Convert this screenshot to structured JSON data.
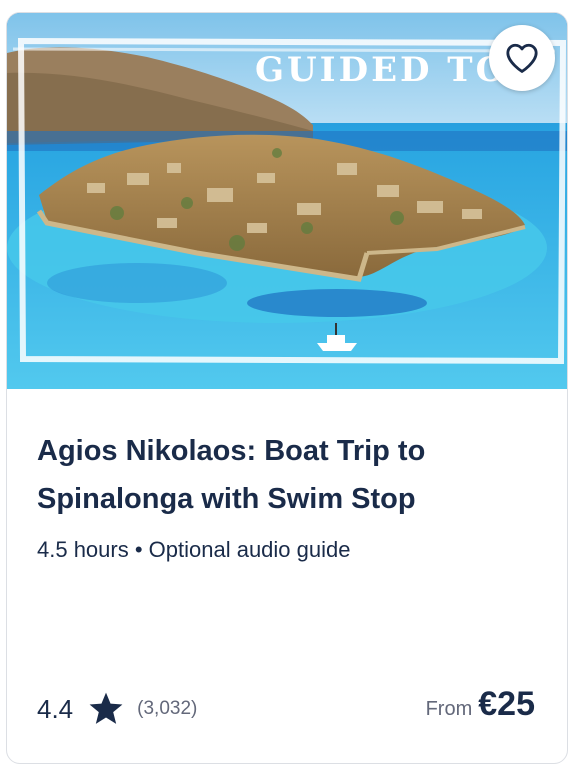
{
  "hero": {
    "overlay_text": "GUIDED TOU",
    "photo_icon": "island-fortress-photo"
  },
  "wishlist": {
    "icon": "heart-outline-icon"
  },
  "tour": {
    "title": "Agios Nikolaos: Boat Trip to Spinalonga with Swim Stop",
    "meta": "4.5 hours • Optional audio guide"
  },
  "rating": {
    "value": "4.4",
    "icon": "star-icon",
    "count": "(3,032)"
  },
  "price": {
    "prefix": "From",
    "amount": "€25"
  },
  "colors": {
    "text_primary": "#1a2b49",
    "text_secondary": "#63687a",
    "sea": "#2fb4e6",
    "border": "#dcdfe4"
  }
}
